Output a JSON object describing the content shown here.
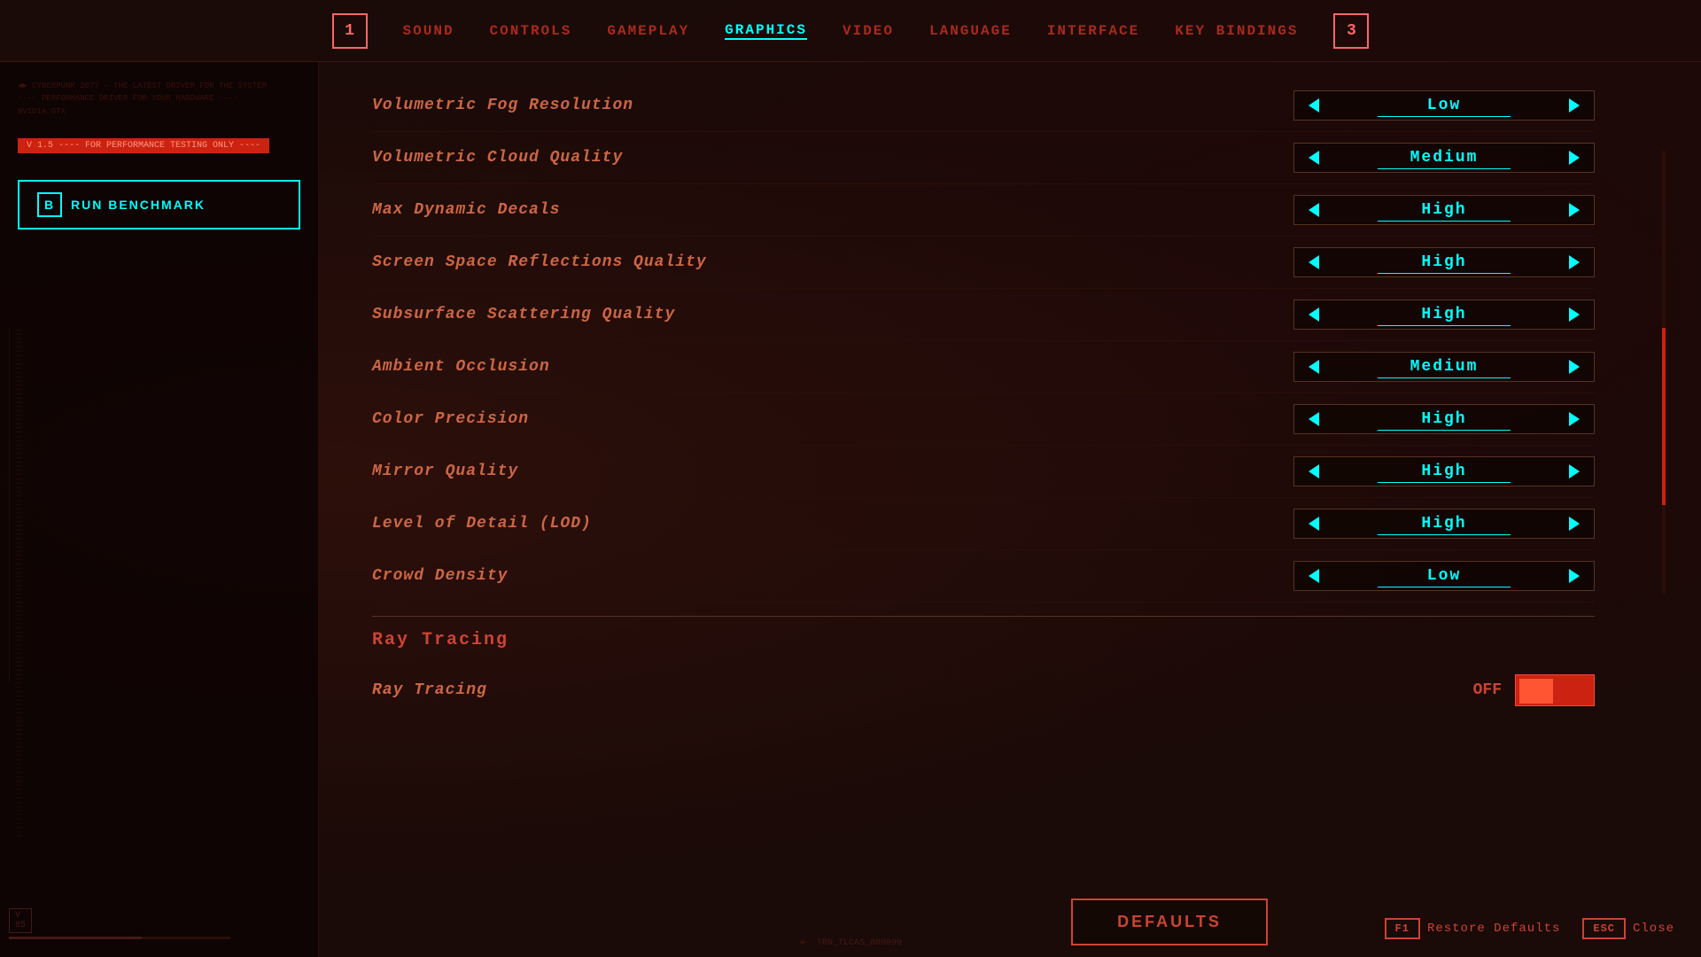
{
  "nav": {
    "left_number": "1",
    "right_number": "3",
    "items": [
      {
        "label": "SOUND",
        "active": false
      },
      {
        "label": "CONTROLS",
        "active": false
      },
      {
        "label": "GAMEPLAY",
        "active": false
      },
      {
        "label": "GRAPHICS",
        "active": true
      },
      {
        "label": "VIDEO",
        "active": false
      },
      {
        "label": "LANGUAGE",
        "active": false
      },
      {
        "label": "INTERFACE",
        "active": false
      },
      {
        "label": "KEY BINDINGS",
        "active": false
      }
    ]
  },
  "sidebar": {
    "version_badge": "V 1.5 ---- FOR PERFORMANCE TESTING ONLY ----",
    "run_benchmark": {
      "key": "B",
      "label": "RUN BENCHMARK"
    }
  },
  "settings": [
    {
      "label": "Volumetric Fog Resolution",
      "value": "Low"
    },
    {
      "label": "Volumetric Cloud Quality",
      "value": "Medium"
    },
    {
      "label": "Max Dynamic Decals",
      "value": "High"
    },
    {
      "label": "Screen Space Reflections Quality",
      "value": "High"
    },
    {
      "label": "Subsurface Scattering Quality",
      "value": "High"
    },
    {
      "label": "Ambient Occlusion",
      "value": "Medium"
    },
    {
      "label": "Color Precision",
      "value": "High"
    },
    {
      "label": "Mirror Quality",
      "value": "High"
    },
    {
      "label": "Level of Detail (LOD)",
      "value": "High"
    },
    {
      "label": "Crowd Density",
      "value": "Low"
    }
  ],
  "ray_tracing_section": {
    "title": "Ray Tracing",
    "setting_label": "Ray Tracing",
    "toggle_state": "OFF"
  },
  "bottom": {
    "defaults_btn": "DEFAULTS",
    "restore_key": "F1",
    "restore_label": "Restore Defaults",
    "close_key": "ESC",
    "close_label": "Close"
  },
  "version": {
    "badge": "V\n85",
    "center_text": "TRN_TLCAS_800099"
  }
}
